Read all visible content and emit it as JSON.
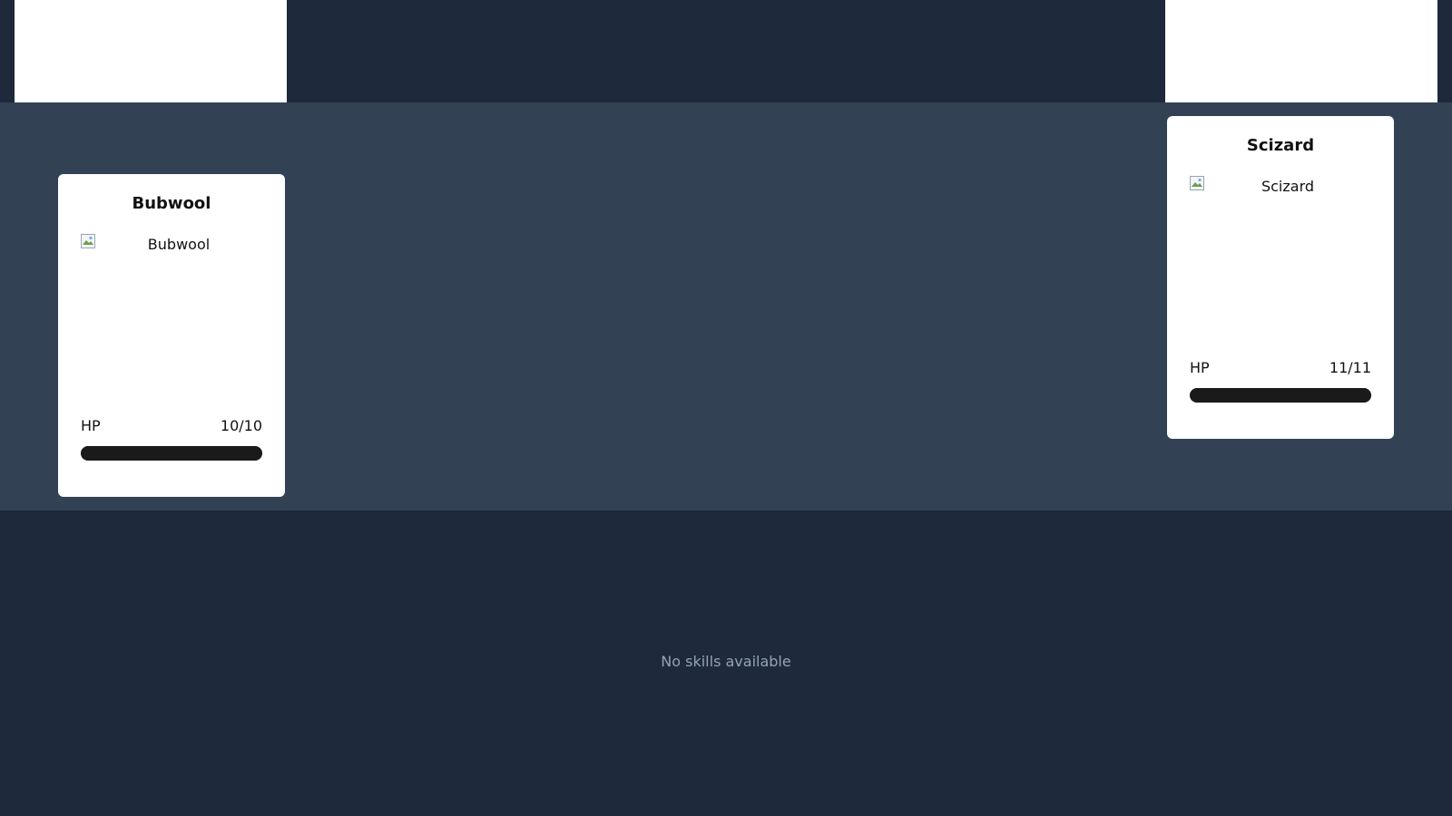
{
  "player_monster": {
    "name": "Bubwool",
    "image_alt": "Bubwool",
    "hp_label": "HP",
    "hp_text": "10/10",
    "hp_fraction": 1.0
  },
  "enemy_monster": {
    "name": "Scizard",
    "image_alt": "Scizard",
    "hp_label": "HP",
    "hp_text": "11/11",
    "hp_fraction": 1.0
  },
  "skills": {
    "empty_text": "No skills available"
  },
  "colors": {
    "background": "#1e293b",
    "battlefield": "#334155",
    "card": "#ffffff",
    "hp_bar": "#1a1a1a",
    "muted_text": "#94a3b8"
  }
}
